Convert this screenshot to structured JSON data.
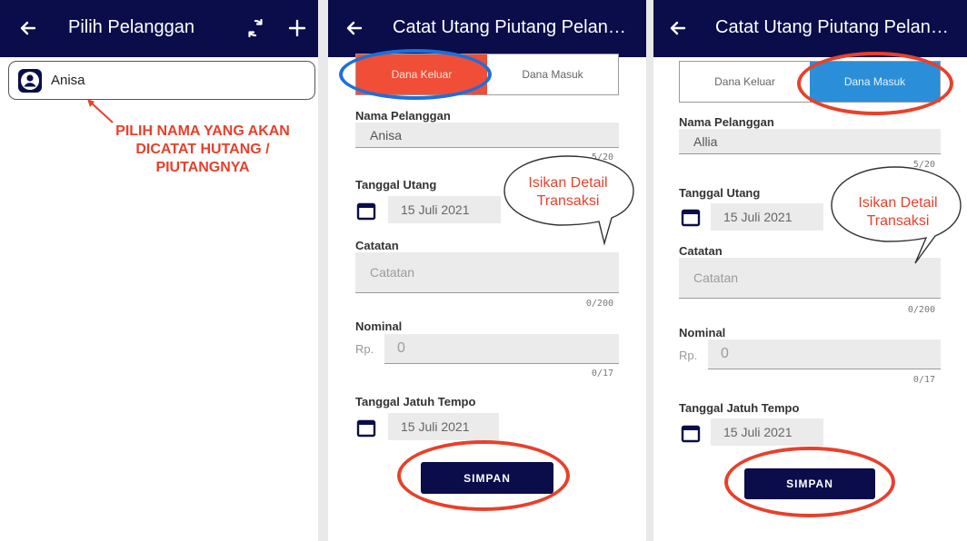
{
  "screen1": {
    "title": "Pilih Pelanggan",
    "customer": "Anisa",
    "annotation": [
      "PILIH NAMA YANG AKAN",
      "DICATAT HUTANG /",
      "PIUTANGNYA"
    ]
  },
  "screen2": {
    "title": "Catat Utang Piutang Pelanggan",
    "tab_out": "Dana Keluar",
    "tab_in": "Dana Masuk",
    "active_tab": "Dana Keluar",
    "name_label": "Nama Pelanggan",
    "name_value": "Anisa",
    "name_counter": "5/20",
    "date_label": "Tanggal Utang",
    "date_value": "15 Juli 2021",
    "note_label": "Catatan",
    "note_placeholder": "Catatan",
    "note_counter": "0/200",
    "nominal_label": "Nominal",
    "currency": "Rp.",
    "nominal_value": "0",
    "nominal_counter": "0/17",
    "due_label": "Tanggal Jatuh Tempo",
    "due_value": "15 Juli 2021",
    "save_label": "SIMPAN",
    "bubble": [
      "Isikan Detail",
      "Transaksi"
    ]
  },
  "screen3": {
    "title": "Catat Utang Piutang Pelanggan",
    "tab_out": "Dana Keluar",
    "tab_in": "Dana Masuk",
    "active_tab": "Dana Masuk",
    "name_label": "Nama Pelanggan",
    "name_value": "Allia",
    "name_counter": "5/20",
    "date_label": "Tanggal Utang",
    "date_value": "15 Juli 2021",
    "note_label": "Catatan",
    "note_placeholder": "Catatan",
    "note_counter": "0/200",
    "nominal_label": "Nominal",
    "currency": "Rp.",
    "nominal_value": "0",
    "nominal_counter": "0/17",
    "due_label": "Tanggal Jatuh Tempo",
    "due_value": "15 Juli 2021",
    "save_label": "SIMPAN",
    "bubble": [
      "Isikan Detail",
      "Transaksi"
    ]
  },
  "colors": {
    "appbar": "#0a0d4a",
    "annotation_red": "#e8402b",
    "tab_red": "#f04e37",
    "tab_blue": "#2a8fd8",
    "highlight_blue": "#1e6fd9"
  },
  "icons": [
    "back-arrow-icon",
    "refresh-icon",
    "add-icon",
    "person-icon",
    "calendar-icon"
  ]
}
